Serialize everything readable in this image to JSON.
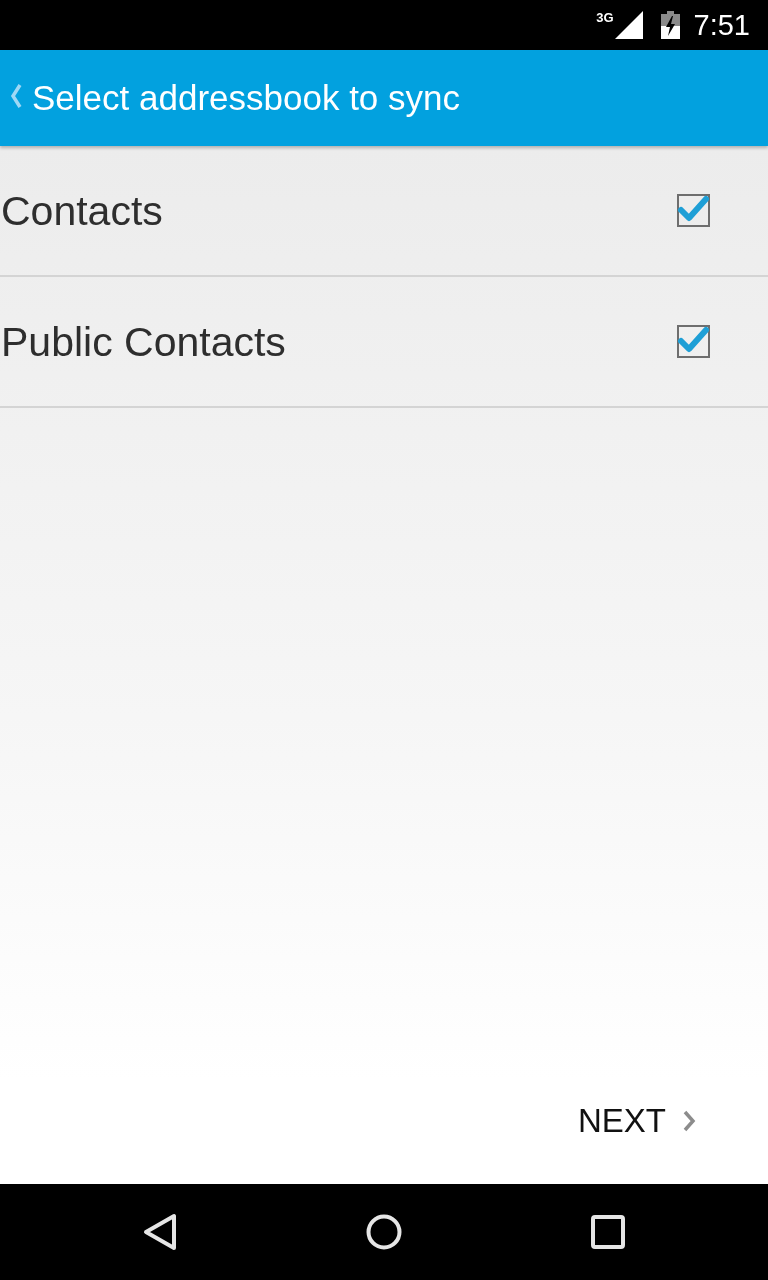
{
  "status_bar": {
    "network": "3G",
    "time": "7:51"
  },
  "app_bar": {
    "title": "Select addressbook to sync"
  },
  "addressbooks": [
    {
      "name": "Contacts",
      "checked": true
    },
    {
      "name": "Public Contacts",
      "checked": true
    }
  ],
  "next_button": {
    "label": "NEXT"
  }
}
